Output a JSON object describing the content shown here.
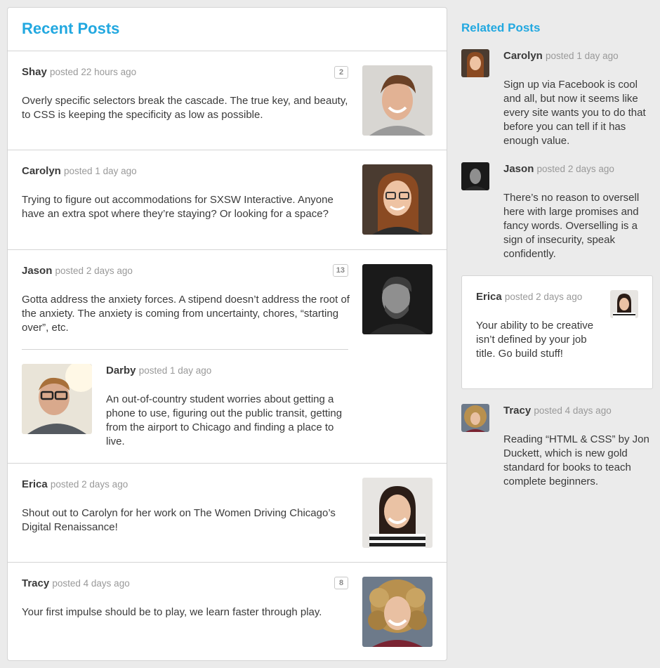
{
  "main": {
    "title": "Recent Posts",
    "posts": [
      {
        "author": "Shay",
        "time": "posted 22 hours ago",
        "badge": "2",
        "body": "Overly specific selectors break the cascade. The true key, and beauty, to CSS is keeping the specificity as low as possible."
      },
      {
        "author": "Carolyn",
        "time": "posted 1 day ago",
        "body": "Trying to figure out accommodations for SXSW Interactive. Anyone have an extra spot where they’re staying? Or looking for a space?"
      },
      {
        "author": "Jason",
        "time": "posted 2 days ago",
        "badge": "13",
        "body": "Gotta address the anxiety forces. A stipend doesn’t address the root of the anxiety. The anxiety is coming from uncertainty, chores, “starting over”, etc.",
        "reply": {
          "author": "Darby",
          "time": "posted 1 day ago",
          "body": "An out-of-country student worries about getting a phone to use, figuring out the public transit, getting from the airport to Chicago and finding a place to live."
        }
      },
      {
        "author": "Erica",
        "time": "posted 2 days ago",
        "body": "Shout out to Carolyn for her work on The Women Driving Chicago’s Digital Renaissance!"
      },
      {
        "author": "Tracy",
        "time": "posted 4 days ago",
        "badge": "8",
        "body": "Your first impulse should be to play, we learn faster through play."
      }
    ]
  },
  "sidebar": {
    "title": "Related Posts",
    "items": [
      {
        "author": "Carolyn",
        "time": "posted 1 day ago",
        "body": "Sign up via Facebook is cool and all, but now it seems like every site wants you to do that before you can tell if it has enough value."
      },
      {
        "author": "Jason",
        "time": "posted 2 days ago",
        "body": "There’s no reason to oversell here with large promises and fancy words. Overselling is a sign of insecurity, speak confidently."
      },
      {
        "author": "Erica",
        "time": "posted 2 days ago",
        "body": "Your ability to be creative isn’t defined by your job title. Go build stuff!"
      },
      {
        "author": "Tracy",
        "time": "posted 4 days ago",
        "body": "Reading “HTML & CSS” by Jon Duckett, which is new gold standard for books to teach complete beginners."
      }
    ]
  },
  "colors": {
    "accent": "#22a8e0",
    "muted": "#999999",
    "border": "#d4d4d4"
  }
}
